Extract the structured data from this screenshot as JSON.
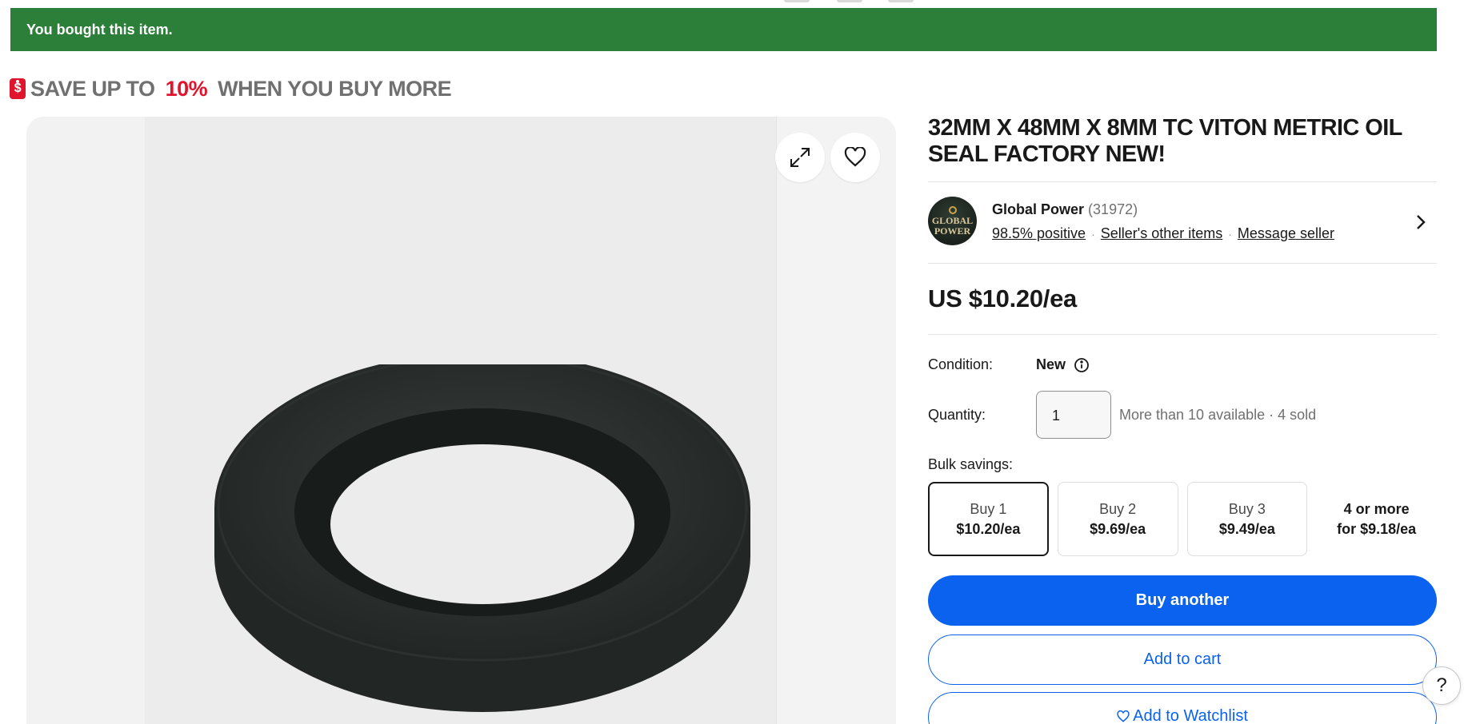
{
  "banner": {
    "text": "You bought this item."
  },
  "promo": {
    "prefix": "SAVE UP TO ",
    "percent": "10%",
    "suffix": " WHEN YOU BUY MORE",
    "icon": "price-tag-dollar-icon"
  },
  "gallery": {
    "expand_icon": "expand-icon",
    "watch_icon": "heart-icon"
  },
  "listing": {
    "title": "32MM X 48MM X 8MM TC VITON METRIC OIL SEAL FACTORY NEW!"
  },
  "seller": {
    "avatar_text_1": "GLOBAL",
    "avatar_text_2": "POWER",
    "name": "Global Power",
    "feedback_count": "(31972)",
    "positive": "98.5% positive",
    "other_items": "Seller's other items",
    "message": "Message seller",
    "sep": "·"
  },
  "price": {
    "text": "US $10.20/ea"
  },
  "condition": {
    "label": "Condition:",
    "value": "New",
    "info_icon": "info-icon"
  },
  "quantity": {
    "label": "Quantity:",
    "value": "1",
    "availability": "More than 10 available · 4 sold"
  },
  "bulk": {
    "label": "Bulk savings:",
    "options": [
      {
        "line1": "Buy 1",
        "line2": "$10.20/ea",
        "selected": true
      },
      {
        "line1": "Buy 2",
        "line2": "$9.69/ea",
        "selected": false
      },
      {
        "line1": "Buy 3",
        "line2": "$9.49/ea",
        "selected": false
      },
      {
        "line1": "4 or more",
        "line2": "for $9.18/ea",
        "selected": false
      }
    ]
  },
  "actions": {
    "buy_another": "Buy another",
    "add_to_cart": "Add to cart",
    "add_to_watchlist": "Add to Watchlist"
  },
  "help": {
    "label": "?"
  },
  "colors": {
    "banner_green": "#2b7f38",
    "accent_blue": "#0a62ee",
    "promo_red": "#e0142c"
  }
}
